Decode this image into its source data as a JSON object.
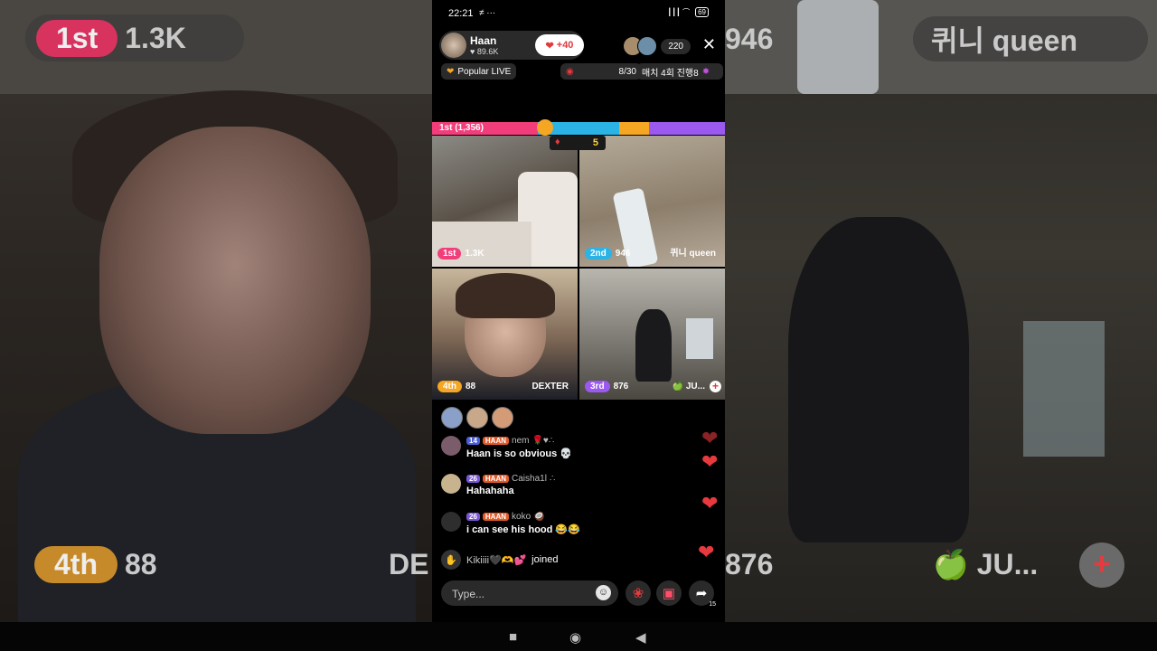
{
  "background": {
    "left": {
      "rank": "1st",
      "score": "1.3K",
      "bottom_rank": "4th",
      "bottom_score": "88",
      "bottom_name": "DE"
    },
    "right": {
      "score": "946",
      "name": "퀴니 queen",
      "bottom_score": "876",
      "bottom_name": "🍏 JU...",
      "plus": "+"
    }
  },
  "status_bar": {
    "time": "22:21",
    "left_icons": "≠ ···",
    "right_icons": "┃┃┃ ⌒",
    "battery": "69"
  },
  "host": {
    "name": "Haan",
    "likes": "89.6K",
    "follow_label": "+40"
  },
  "viewers": {
    "count": "220"
  },
  "chips": {
    "popular": "Popular LIVE",
    "progress": "8/30",
    "match": "매치 4회 진행8"
  },
  "battle": {
    "label": "1st (1,356)",
    "round": "5",
    "segments": [
      {
        "share": 0.36,
        "color": "#f23d7b"
      },
      {
        "share": 0.28,
        "color": "#2bb3e6"
      },
      {
        "share": 0.1,
        "color": "#f5a623"
      },
      {
        "share": 0.26,
        "color": "#9b59f0"
      }
    ]
  },
  "tiles": [
    {
      "rank": "1st",
      "score": "1.3K",
      "name": "",
      "color": "#f23d7b"
    },
    {
      "rank": "2nd",
      "score": "946",
      "name": "퀴니 queen",
      "color": "#2bb3e6"
    },
    {
      "rank": "4th",
      "score": "88",
      "name": "DEXTER",
      "color": "#f5a623"
    },
    {
      "rank": "3rd",
      "score": "876",
      "name": "🍏 JU...",
      "color": "#9b59f0"
    }
  ],
  "comments": [
    {
      "level": "14",
      "fan": "HAAN",
      "user": "nem",
      "badges": "🌹♥∴",
      "text": "Haan is so obvious 💀"
    },
    {
      "level": "26",
      "fan": "HAAN",
      "user": "Caisha1l",
      "badges": "∴",
      "text": "Hahahaha"
    },
    {
      "level": "26",
      "fan": "HAAN",
      "user": "koko",
      "badges": "🥥",
      "text": "i can see his hood 😂😂"
    }
  ],
  "joined": {
    "user": "Kikiiii🖤🫶💕",
    "text": "joined"
  },
  "input": {
    "placeholder": "Type..."
  },
  "share_count": "15",
  "colors": {
    "accent": "#e8393e",
    "panel": "#2a2a2a"
  }
}
